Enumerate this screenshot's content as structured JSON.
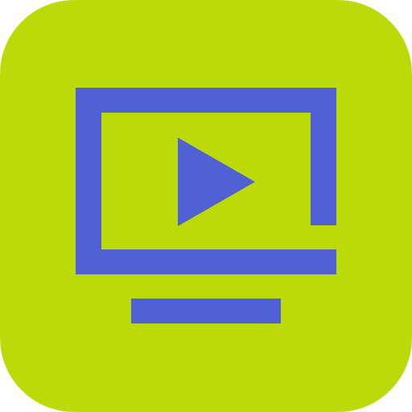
{
  "app_icon": {
    "icon": "tv-play-icon",
    "background_color": "#bcd90a",
    "glyph_color": "#5061d5"
  }
}
